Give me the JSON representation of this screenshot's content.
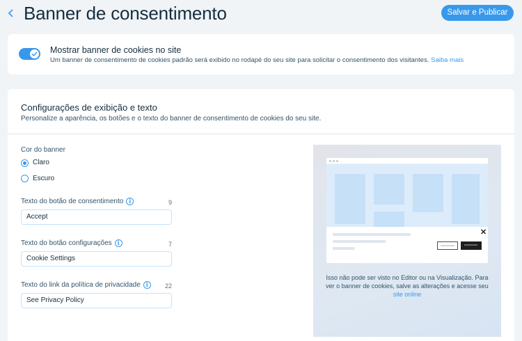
{
  "header": {
    "title": "Banner de consentimento",
    "save_label": "Salvar e Publicar"
  },
  "banner_toggle": {
    "enabled": true,
    "title": "Mostrar banner de cookies no site",
    "description": "Um banner de consentimento de cookies padrão será exibido no rodapé do seu site para solicitar o consentimento dos visitantes.",
    "learn_more": "Saiba mais"
  },
  "settings": {
    "title": "Configurações de exibição e texto",
    "description": "Personalize a aparência, os botões e o texto do banner de consentimento de cookies do seu site.",
    "color": {
      "label": "Cor do banner",
      "options": [
        "Claro",
        "Escuro"
      ],
      "selected": "Claro"
    },
    "consent_button": {
      "label": "Texto do botão de consentimento",
      "count": "9",
      "value": "Accept"
    },
    "settings_button": {
      "label": "Texto do botão configurações",
      "count": "7",
      "value": "Cookie Settings"
    },
    "privacy_link": {
      "label": "Texto do link da política de privacidade",
      "count": "22",
      "value": "See Privacy Policy"
    }
  },
  "preview": {
    "note": "Isso não pode ser visto no Editor ou na Visualização. Para ver o banner de cookies, salve as alterações e acesse seu",
    "link": "site online",
    "close_symbol": "✕"
  },
  "colors": {
    "accent": "#3899ec",
    "text": "#162d3d",
    "background": "#f0f4f7"
  },
  "icons": [
    "chevron-left-icon",
    "check-icon",
    "info-icon",
    "close-icon"
  ]
}
